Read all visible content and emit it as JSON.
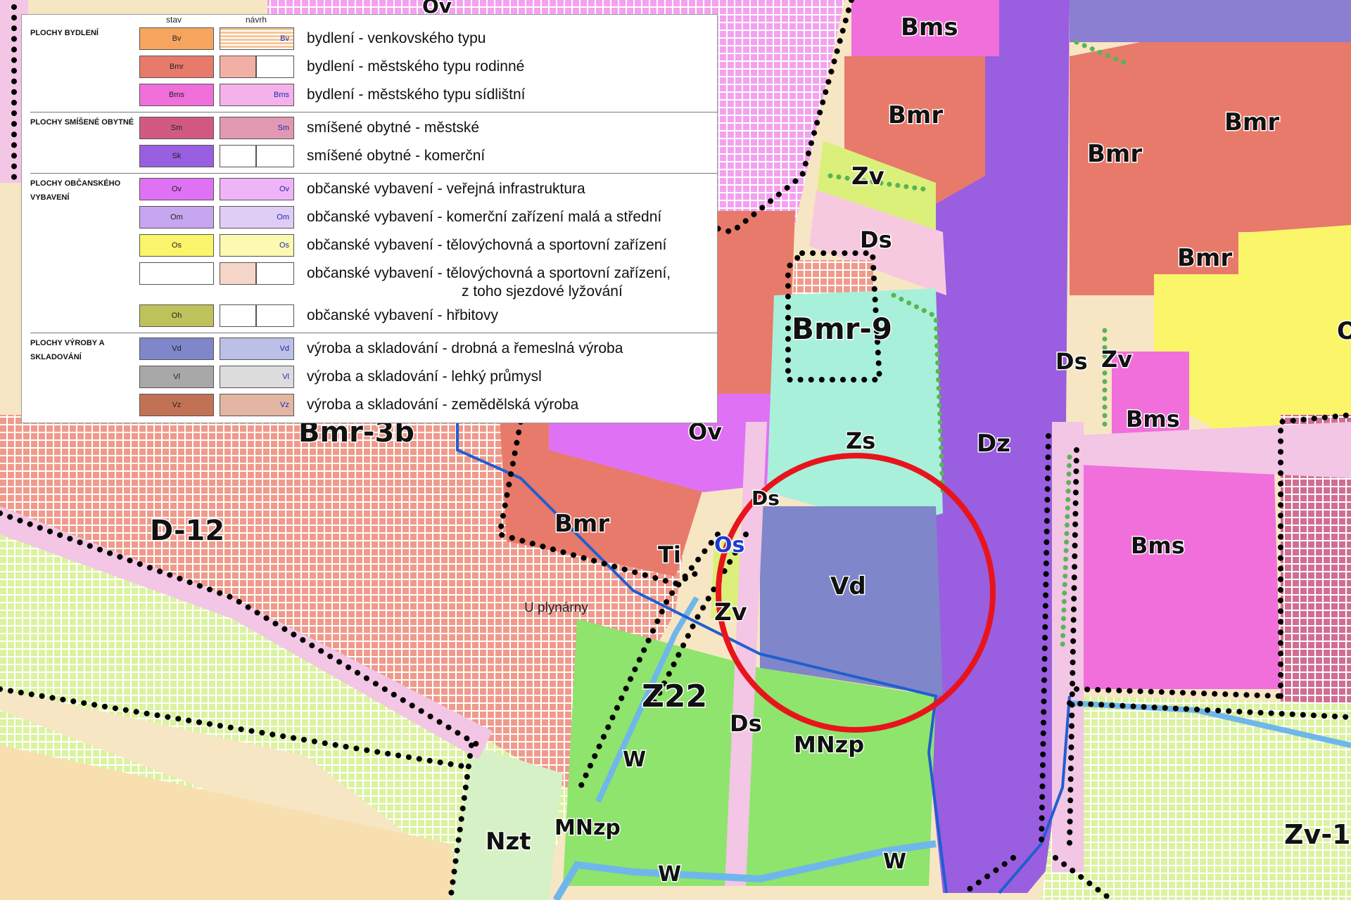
{
  "legend": {
    "col_stav": "stav",
    "col_navrh": "návrh",
    "groups": [
      {
        "title": "PLOCHY BYDLENÍ",
        "items": [
          {
            "code": "Bv",
            "color": "#f6a55f",
            "desc": "bydlení - venkovského typu"
          },
          {
            "code": "Bmr",
            "color": "#e87a6b",
            "desc": "bydlení - městského typu rodinné"
          },
          {
            "code": "Bms",
            "color": "#f06fdb",
            "desc": "bydlení - městského typu sídlištní"
          }
        ]
      },
      {
        "title": "PLOCHY SMÍŠENÉ OBYTNÉ",
        "items": [
          {
            "code": "Sm",
            "color": "#d25a80",
            "desc": "smíšené obytné - městské"
          },
          {
            "code": "Sk",
            "color": "#9a5ee0",
            "desc": "smíšené obytné - komerční"
          }
        ]
      },
      {
        "title": "PLOCHY OBČANSKÉHO VYBAVENÍ",
        "items": [
          {
            "code": "Ov",
            "color": "#df72f4",
            "desc": "občanské vybavení - veřejná infrastruktura"
          },
          {
            "code": "Om",
            "color": "#c7a6f0",
            "desc": "občanské vybavení - komerční zařízení malá a střední"
          },
          {
            "code": "Os",
            "color": "#faf56a",
            "desc": "občanské vybavení - tělovýchovná a sportovní zařízení"
          },
          {
            "code": "",
            "color": "#ffffff",
            "desc": "občanské vybavení - tělovýchovná a sportovní zařízení,",
            "desc2": "z toho sjezdové lyžování"
          },
          {
            "code": "Oh",
            "color": "#bfc25a",
            "desc": "občanské vybavení - hřbitovy"
          }
        ]
      },
      {
        "title": "PLOCHY VÝROBY A SKLADOVÁNÍ",
        "items": [
          {
            "code": "Vd",
            "color": "#7f86c9",
            "desc": "výroba a skladování - drobná a řemeslná výroba"
          },
          {
            "code": "Vl",
            "color": "#a8a8a8",
            "desc": "výroba a skladování - lehký průmysl"
          },
          {
            "code": "Vz",
            "color": "#c27254",
            "desc": "výroba a skladování - zemědělská výroba"
          }
        ]
      }
    ]
  },
  "zones": {
    "Bms_top": "Bms",
    "Bmr_a": "Bmr",
    "Bmr_b": "Bmr",
    "Bmr_c": "Bmr",
    "Bmr_d": "Bmr",
    "Bmr_e": "Bmr",
    "Zv_a": "Zv",
    "Ds_a": "Ds",
    "Bmr9": "Bmr-9",
    "Ds_b": "Ds",
    "Zv_b": "Zv",
    "Bms_b": "Bms",
    "Bmr3b": "Bmr-3b",
    "Ov": "Ov",
    "Zs": "Zs",
    "Dz": "Dz",
    "D12": "D-12",
    "Ds_c": "Ds",
    "Ti": "Ti",
    "Os": "Os",
    "Bms_c": "Bms",
    "Vd": "Vd",
    "Zv_c": "Zv",
    "Z22": "Z22",
    "Ds_d": "Ds",
    "MNzp_a": "MNzp",
    "W_a": "W",
    "Nzt": "Nzt",
    "MNzp_b": "MNzp",
    "W_b": "W",
    "W_c": "W",
    "Zv1": "Zv-1",
    "O_edge": "O",
    "Ov_edge": "Ov",
    "U_plynarny": "U plynárny"
  }
}
